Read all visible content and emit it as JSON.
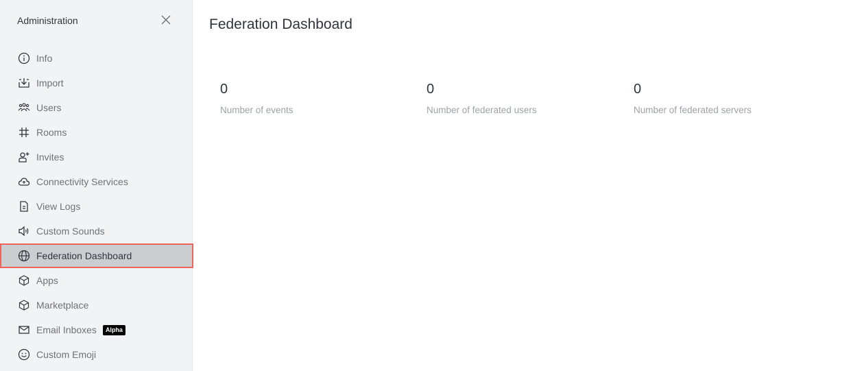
{
  "sidebar": {
    "title": "Administration",
    "items": [
      {
        "label": "Info",
        "icon": "info-circle-icon"
      },
      {
        "label": "Import",
        "icon": "import-icon"
      },
      {
        "label": "Users",
        "icon": "users-icon"
      },
      {
        "label": "Rooms",
        "icon": "hashtag-icon"
      },
      {
        "label": "Invites",
        "icon": "user-plus-icon"
      },
      {
        "label": "Connectivity Services",
        "icon": "cloud-icon"
      },
      {
        "label": "View Logs",
        "icon": "document-icon"
      },
      {
        "label": "Custom Sounds",
        "icon": "volume-icon"
      },
      {
        "label": "Federation Dashboard",
        "icon": "globe-icon",
        "active": true
      },
      {
        "label": "Apps",
        "icon": "cube-icon"
      },
      {
        "label": "Marketplace",
        "icon": "cube-icon"
      },
      {
        "label": "Email Inboxes",
        "icon": "mail-icon",
        "badge": "Alpha"
      },
      {
        "label": "Custom Emoji",
        "icon": "emoji-icon"
      }
    ]
  },
  "main": {
    "title": "Federation Dashboard",
    "stats": [
      {
        "value": "0",
        "label": "Number of events"
      },
      {
        "value": "0",
        "label": "Number of federated users"
      },
      {
        "value": "0",
        "label": "Number of federated servers"
      }
    ]
  },
  "colors": {
    "sidebar_bg": "#f2f3f5",
    "active_bg": "#cbced1",
    "highlight_border": "#f0645a",
    "badge_bg": "#000000"
  }
}
